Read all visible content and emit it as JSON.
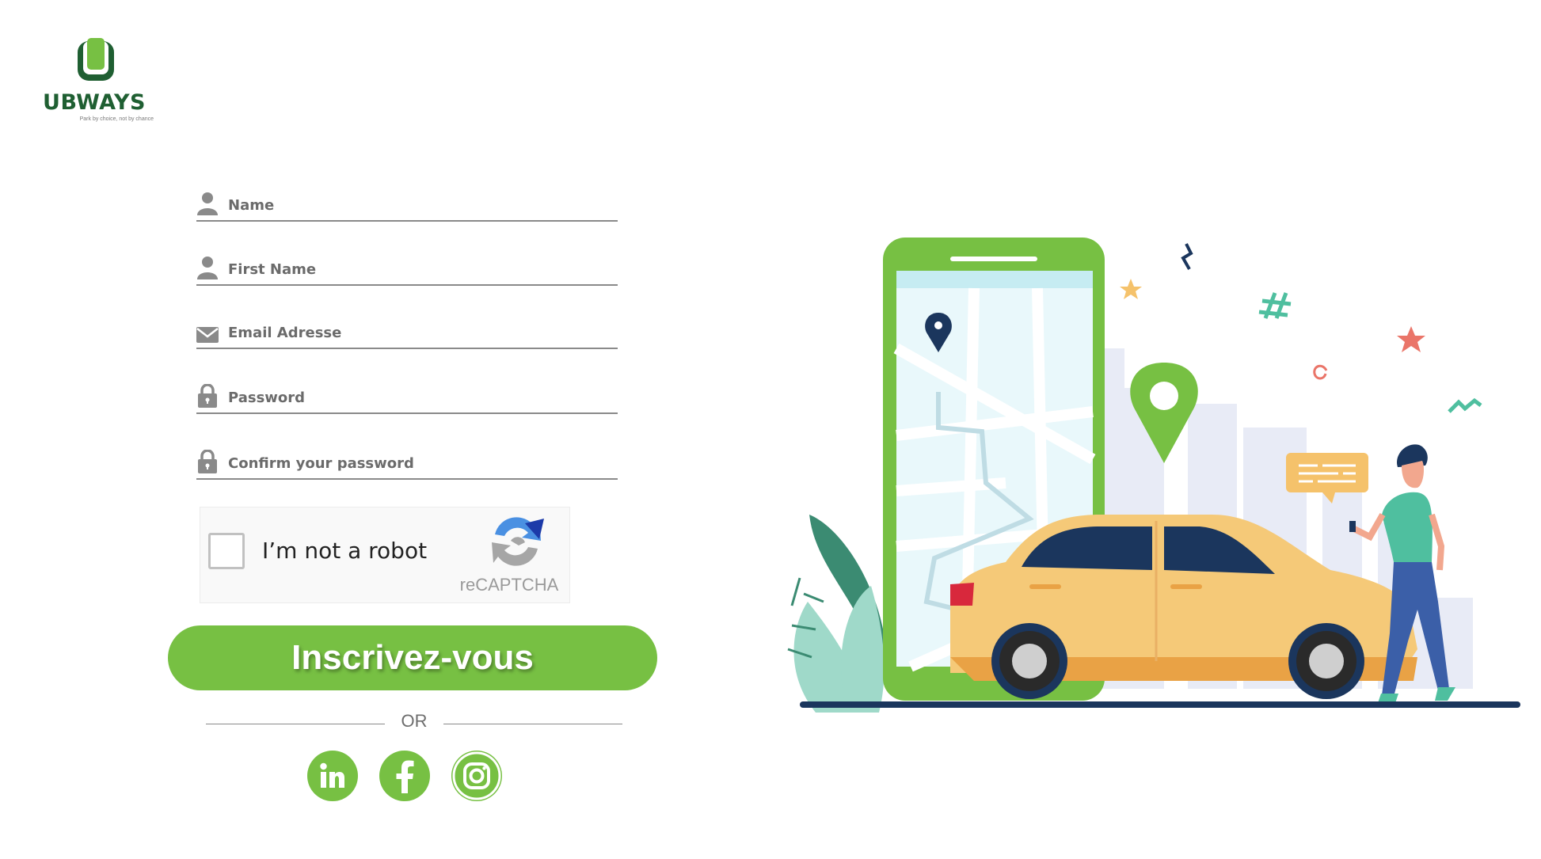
{
  "brand": {
    "name": "UBWAYS",
    "tagline": "Park by choice, not by chance",
    "color": "#77c043",
    "dark_color": "#1f5f32"
  },
  "form": {
    "fields": [
      {
        "placeholder": "Name",
        "icon": "user-icon"
      },
      {
        "placeholder": "First Name",
        "icon": "user-icon"
      },
      {
        "placeholder": "Email Adresse",
        "icon": "envelope-icon"
      },
      {
        "placeholder": "Password",
        "icon": "lock-icon"
      },
      {
        "placeholder": "Confirm your password",
        "icon": "lock-icon"
      }
    ],
    "captcha": {
      "label": "I’m not a robot",
      "brand": "reCAPTCHA"
    },
    "submit_label": "Inscrivez-vous",
    "divider_text": "OR"
  },
  "social": [
    {
      "name": "linkedin",
      "icon": "linkedin-icon"
    },
    {
      "name": "facebook",
      "icon": "facebook-icon"
    },
    {
      "name": "instagram",
      "icon": "instagram-icon"
    }
  ]
}
